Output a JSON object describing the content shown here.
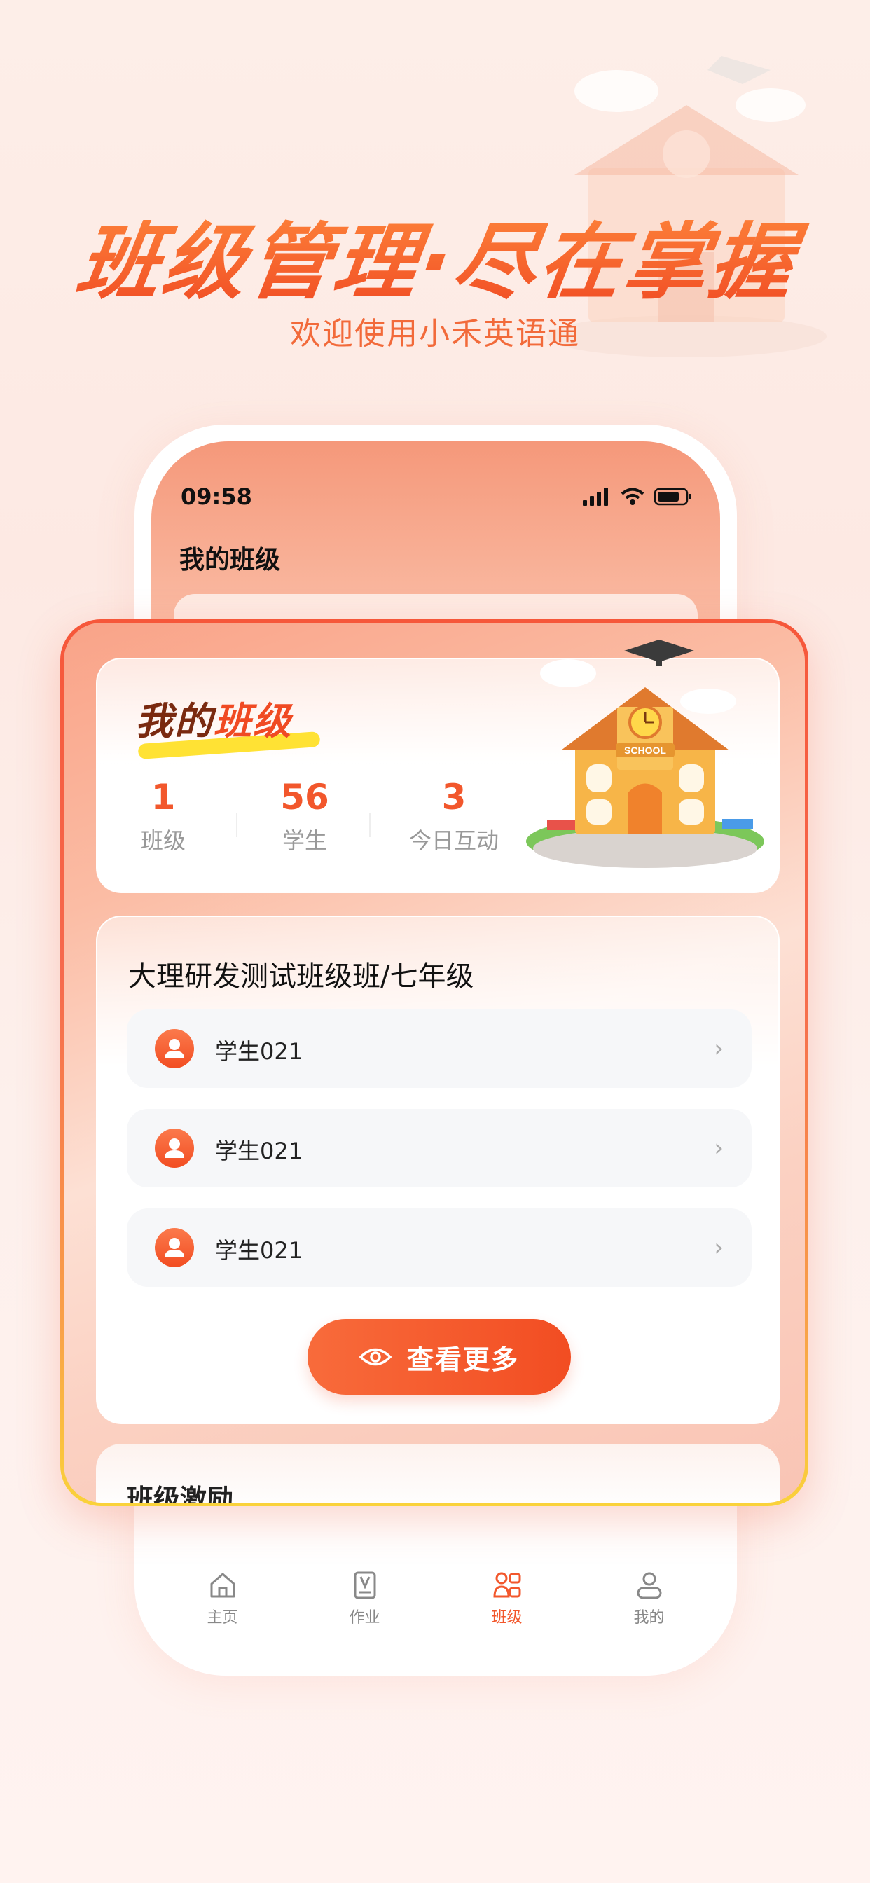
{
  "hero": {
    "title": "班级管理·尽在掌握",
    "subtitle": "欢迎使用小禾英语通"
  },
  "status_bar": {
    "time": "09:58"
  },
  "screen": {
    "title": "我的班级"
  },
  "summary": {
    "title_part1": "我的",
    "title_part2": "班级",
    "stats": [
      {
        "value": "1",
        "label": "班级"
      },
      {
        "value": "56",
        "label": "学生"
      },
      {
        "value": "3",
        "label": "今日互动"
      }
    ],
    "school_sign": "SCHOOL"
  },
  "class_card": {
    "name": "大理研发测试班级班/七年级",
    "students": [
      {
        "name": "学生021"
      },
      {
        "name": "学生021"
      },
      {
        "name": "学生021"
      }
    ],
    "more_label": "查看更多"
  },
  "reward": {
    "title": "班级激励"
  },
  "tabs": [
    {
      "label": "主页",
      "icon": "home-icon"
    },
    {
      "label": "作业",
      "icon": "homework-icon"
    },
    {
      "label": "班级",
      "icon": "class-icon",
      "active": true
    },
    {
      "label": "我的",
      "icon": "profile-icon"
    }
  ],
  "colors": {
    "accent": "#f2572c",
    "accent_light": "#f86b3b",
    "highlight": "#ffe234"
  }
}
